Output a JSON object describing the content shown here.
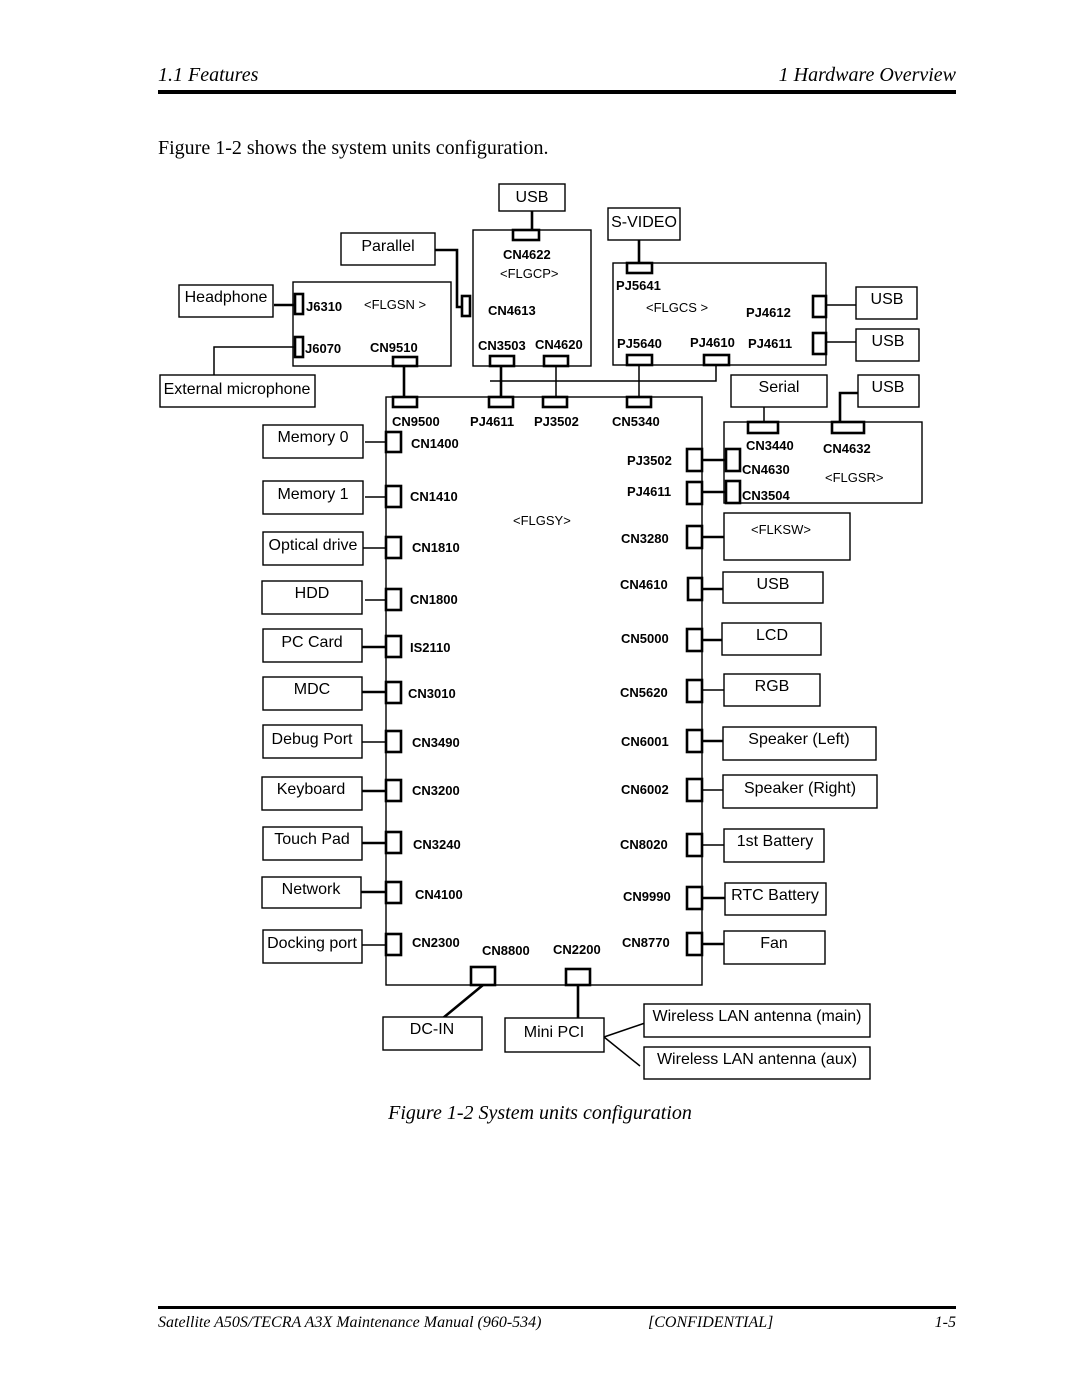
{
  "header": {
    "left": "1.1  Features",
    "right": "1 Hardware Overview"
  },
  "intro": "Figure 1-2 shows the system units configuration.",
  "caption": "Figure 1-2 System units configuration",
  "footer": {
    "left": "Satellite A50S/TECRA A3X  Maintenance Manual (960-534)",
    "center": "[CONFIDENTIAL]",
    "right": "1-5"
  },
  "diagram": {
    "boards": {
      "flgsn": "<FLGSN >",
      "flgcp": "<FLGCP>",
      "flgcs": "<FLGCS >",
      "flgsy": "<FLGSY>",
      "flgsr": "<FLGSR>",
      "flksw": "<FLKSW>"
    },
    "devices": {
      "usb_top": "USB",
      "svideo": "S-VIDEO",
      "parallel": "Parallel",
      "headphone": "Headphone",
      "ext_mic": "External microphone",
      "usb_r1": "USB",
      "usb_r2": "USB",
      "serial": "Serial",
      "usb_r3": "USB",
      "memory0": "Memory 0",
      "memory1": "Memory 1",
      "optical": "Optical drive",
      "hdd": "HDD",
      "pccard": "PC Card",
      "mdc": "MDC",
      "debug": "Debug Port",
      "keyboard": "Keyboard",
      "touchpad": "Touch Pad",
      "network": "Network",
      "docking": "Docking port",
      "usb_r4": "USB",
      "lcd": "LCD",
      "rgb": "RGB",
      "spk_l": "Speaker (Left)",
      "spk_r": "Speaker (Right)",
      "bat1": "1st Battery",
      "rtc": "RTC Battery",
      "fan": "Fan",
      "dcin": "DC-IN",
      "minipci": "Mini PCI",
      "wlan_main": "Wireless LAN antenna (main)",
      "wlan_aux": "Wireless LAN antenna (aux)"
    },
    "connectors": {
      "cn4622": "CN4622",
      "cn4613": "CN4613",
      "cn3503": "CN3503",
      "cn4620": "CN4620",
      "j6310": "J6310",
      "j6070": "J6070",
      "cn9510": "CN9510",
      "pj5641": "PJ5641",
      "pj4612": "PJ4612",
      "pj5640": "PJ5640",
      "pj4610": "PJ4610",
      "pj4611a": "PJ4611",
      "cn9500": "CN9500",
      "pj4611b": "PJ4611",
      "pj3502a": "PJ3502",
      "cn5340": "CN5340",
      "cn1400": "CN1400",
      "cn1410": "CN1410",
      "cn1810": "CN1810",
      "cn1800": "CN1800",
      "is2110": "IS2110",
      "cn3010": "CN3010",
      "cn3490": "CN3490",
      "cn3200": "CN3200",
      "cn3240": "CN3240",
      "cn4100": "CN4100",
      "cn2300": "CN2300",
      "cn8800": "CN8800",
      "cn2200": "CN2200",
      "cn8770": "CN8770",
      "pj3502b": "PJ3502",
      "pj4611c": "PJ4611",
      "cn3280": "CN3280",
      "cn4610": "CN4610",
      "cn5000": "CN5000",
      "cn5620": "CN5620",
      "cn6001": "CN6001",
      "cn6002": "CN6002",
      "cn8020": "CN8020",
      "cn9990": "CN9990",
      "cn3440": "CN3440",
      "cn4632": "CN4632",
      "cn4630": "CN4630",
      "cn3504": "CN3504"
    }
  }
}
